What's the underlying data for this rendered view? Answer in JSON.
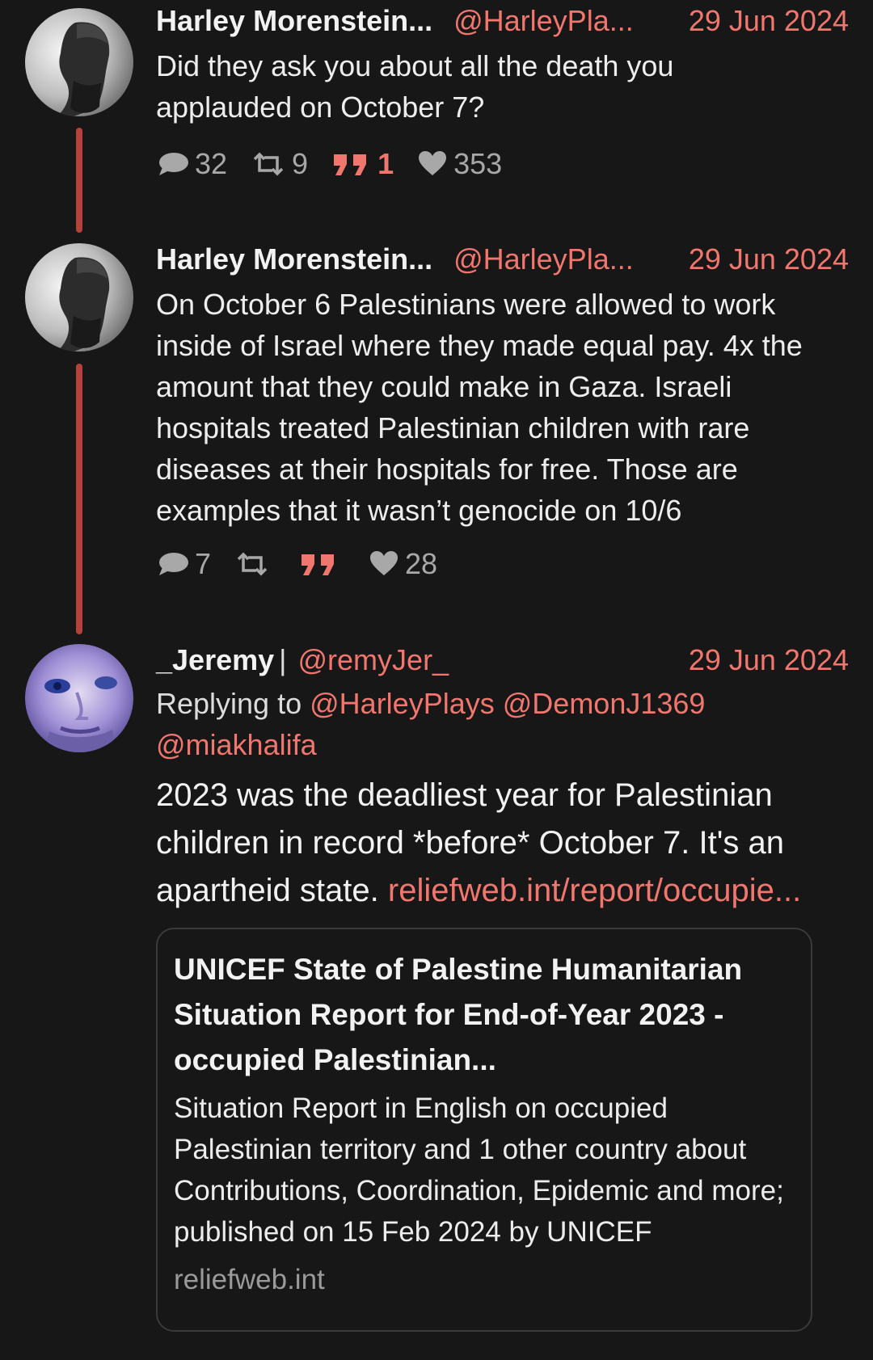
{
  "tweets": [
    {
      "author_name": "Harley Morenstein...",
      "handle": "@HarleyPla...",
      "date": "29 Jun 2024",
      "text": "Did they ask you about all the death you applauded on October 7?",
      "stats": {
        "replies": "32",
        "retweets": "9",
        "quotes": "1",
        "likes": "353"
      }
    },
    {
      "author_name": "Harley Morenstein...",
      "handle": "@HarleyPla...",
      "date": "29 Jun 2024",
      "text": "On October 6 Palestinians were allowed to work inside of Israel where they made equal pay. 4x the amount that they could make in Gaza. Israeli hospitals treated Palestinian children with rare diseases at their hospitals for free. Those are examples that it wasn’t genocide on 10/6",
      "stats": {
        "replies": "7",
        "retweets": "",
        "quotes": "",
        "likes": "28"
      }
    },
    {
      "author_name": "_Jeremy",
      "separator": "|",
      "handle": "@remyJer_",
      "date": "29 Jun 2024",
      "replying_to_label": "Replying to",
      "replying_to": [
        "@HarleyPlays",
        "@DemonJ1369",
        "@miakhalifa"
      ],
      "text": "2023 was the deadliest year for Palestinian children in record *before* October 7. It's an apartheid state.",
      "link_text": "reliefweb.int/report/occupie...",
      "card": {
        "title": "UNICEF State of Palestine Humanitarian Situation Report for End-of-Year 2023 - occupied Palestinian...",
        "description": "Situation Report in English on occupied Palestinian territory and 1 other country about Contributions, Coordination, Epidemic and more; published on 15 Feb 2024 by UNICEF",
        "domain": "reliefweb.int"
      }
    }
  ],
  "colors": {
    "background": "#171717",
    "accent": "#f0766e",
    "thread_line": "#b5403c",
    "muted": "#a8a8a8"
  },
  "icons": [
    "reply-icon",
    "retweet-icon",
    "quote-icon",
    "like-icon"
  ]
}
